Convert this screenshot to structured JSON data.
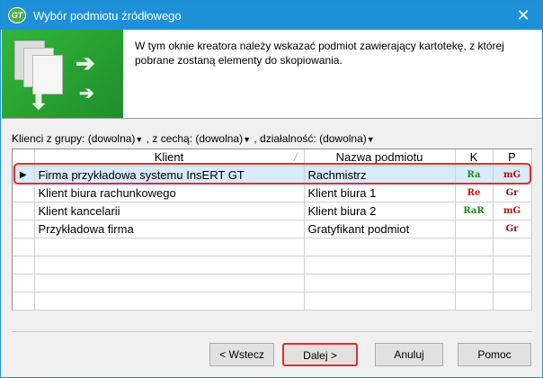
{
  "window": {
    "title": "Wybór podmiotu źródłowego",
    "app_icon_text": "GT",
    "close_glyph": "✕"
  },
  "header": {
    "description": "W tym oknie kreatora należy wskazać podmiot zawierający kartotekę, z której pobrane zostaną elementy do skopiowania."
  },
  "filters": {
    "group_label": "Klienci z grupy:",
    "group_value": "(dowolna)",
    "feature_label": ", z cechą:",
    "feature_value": "(dowolna)",
    "activity_label": ", działalność:",
    "activity_value": "(dowolna)"
  },
  "table": {
    "columns": [
      "Klient",
      "Nazwa podmiotu",
      "K",
      "P"
    ],
    "rows": [
      {
        "client": "Firma przykładowa systemu InsERT GT",
        "entity": "Rachmistrz",
        "k": "Ra",
        "p": "mG",
        "k_color": "#1a8a1a",
        "p_color": "#b01010"
      },
      {
        "client": "Klient biura rachunkowego",
        "entity": "Klient biura 1",
        "k": "Re",
        "p": "Gr",
        "k_color": "#d01010",
        "p_color": "#8a1010"
      },
      {
        "client": "Klient kancelarii",
        "entity": "Klient biura 2",
        "k": "RaR",
        "p": "mG",
        "k_color": "#1a8a1a",
        "p_color": "#b01010"
      },
      {
        "client": "Przykładowa firma",
        "entity": "Gratyfikant podmiot",
        "k": "",
        "p": "Gr",
        "k_color": "#000000",
        "p_color": "#8a1010"
      }
    ],
    "selected_indicator": "▶"
  },
  "buttons": {
    "back": "< Wstecz",
    "next": "Dalej >",
    "cancel": "Anuluj",
    "help": "Pomoc"
  },
  "colors": {
    "titlebar": "#1e90d8",
    "highlight": "#e52b2b",
    "selected_row": "#d7ebfa"
  }
}
